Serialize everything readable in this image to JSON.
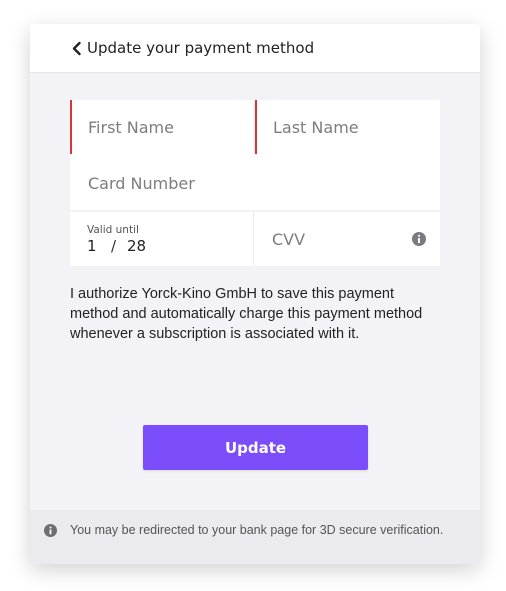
{
  "header": {
    "title": "Update your payment method",
    "back_icon": "chevron-left-icon"
  },
  "form": {
    "first_name": {
      "placeholder": "First Name",
      "value": "",
      "invalid": true
    },
    "last_name": {
      "placeholder": "Last Name",
      "value": "",
      "invalid": true
    },
    "card_number": {
      "placeholder": "Card Number",
      "value": ""
    },
    "valid_until": {
      "label": "Valid until",
      "month": "1",
      "separator": "/",
      "year": "28"
    },
    "cvv": {
      "placeholder": "CVV",
      "info_icon": "info-circle-icon"
    }
  },
  "consent_text": "I authorize Yorck-Kino GmbH to save this payment method and automatically charge this payment method whenever a subscription is associated with it.",
  "update_button": {
    "label": "Update",
    "color": "#7b4dfb"
  },
  "footer": {
    "icon": "info-circle-icon",
    "text": "You may be redirected to your bank page for 3D secure verification."
  },
  "colors": {
    "error": "#d93535",
    "card_bg": "#f3f3f7",
    "footer_bg": "#eaeaef"
  }
}
